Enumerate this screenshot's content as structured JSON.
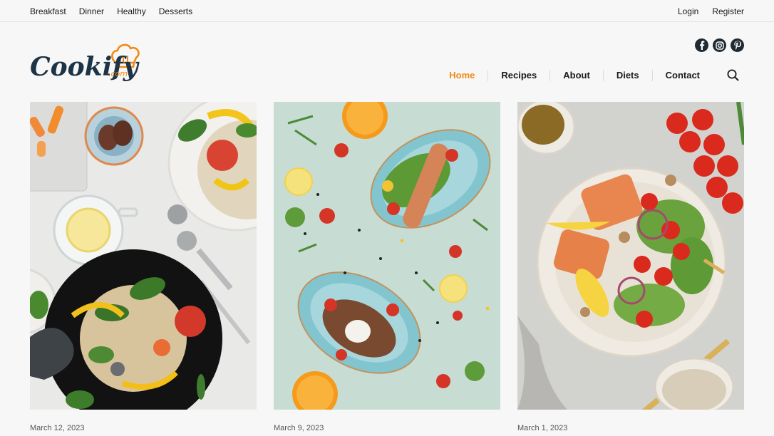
{
  "topbar": {
    "categories": [
      "Breakfast",
      "Dinner",
      "Healthy",
      "Desserts"
    ],
    "login": "Login",
    "register": "Register"
  },
  "logo": {
    "name": "Cookify",
    "suffix": ".com"
  },
  "social": [
    "facebook-icon",
    "instagram-icon",
    "pinterest-icon"
  ],
  "nav": {
    "items": [
      "Home",
      "Recipes",
      "About",
      "Diets",
      "Contact"
    ],
    "active": "Home",
    "accent": "#f08a15"
  },
  "posts": [
    {
      "date": "March 12, 2023",
      "image": "salad-black-plate-photo"
    },
    {
      "date": "March 9, 2023",
      "image": "blue-bowls-salad-photo"
    },
    {
      "date": "March 1, 2023",
      "image": "salmon-salad-photo"
    }
  ]
}
